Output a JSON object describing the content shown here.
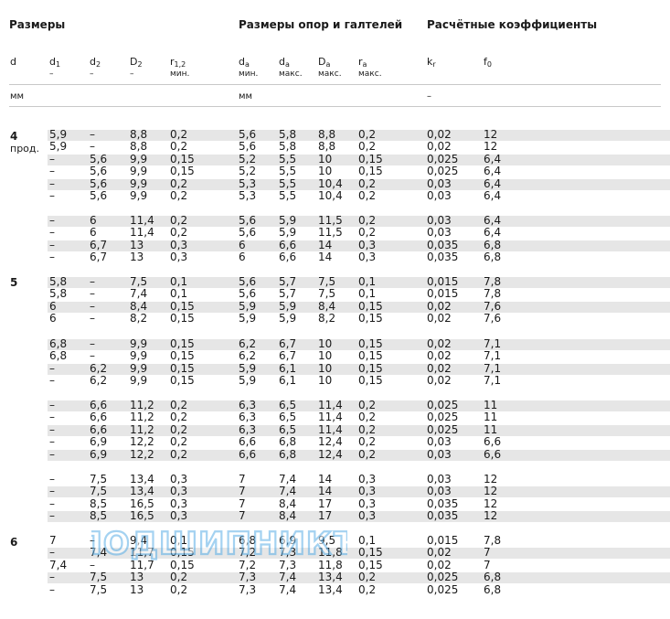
{
  "sections": {
    "sizes": "Размеры",
    "abutment": "Размеры опор и галтелей",
    "factors": "Расчётные коэффициенты"
  },
  "columns": [
    {
      "key": "d",
      "label": "d",
      "sub": "",
      "line2": ""
    },
    {
      "key": "d1",
      "label": "d",
      "sub": "1",
      "line2": "–"
    },
    {
      "key": "d2",
      "label": "d",
      "sub": "2",
      "line2": "–"
    },
    {
      "key": "D2",
      "label": "D",
      "sub": "2",
      "line2": "–"
    },
    {
      "key": "r12",
      "label": "r",
      "sub": "1,2",
      "line2": "мин."
    },
    {
      "key": "da_min",
      "label": "d",
      "sub": "a",
      "line2": "мин."
    },
    {
      "key": "da_max",
      "label": "d",
      "sub": "a",
      "line2": "макс."
    },
    {
      "key": "Da_max",
      "label": "D",
      "sub": "a",
      "line2": "макс."
    },
    {
      "key": "ra_max",
      "label": "r",
      "sub": "a",
      "line2": "макс."
    },
    {
      "key": "kr",
      "label": "k",
      "sub": "r",
      "line2": ""
    },
    {
      "key": "f0",
      "label": "f",
      "sub": "0",
      "line2": ""
    }
  ],
  "units": {
    "sizes": "мм",
    "abutment": "мм",
    "factors": "–"
  },
  "groups": [
    {
      "d": "4",
      "cont": "прод."
    },
    {
      "d": "5",
      "cont": ""
    },
    {
      "d": "6",
      "cont": ""
    }
  ],
  "rows": [
    [
      "5,9",
      "–",
      "8,8",
      "0,2",
      "5,6",
      "5,8",
      "8,8",
      "0,2",
      "0,02",
      "12"
    ],
    [
      "5,9",
      "–",
      "8,8",
      "0,2",
      "5,6",
      "5,8",
      "8,8",
      "0,2",
      "0,02",
      "12"
    ],
    [
      "–",
      "5,6",
      "9,9",
      "0,15",
      "5,2",
      "5,5",
      "10",
      "0,15",
      "0,025",
      "6,4"
    ],
    [
      "–",
      "5,6",
      "9,9",
      "0,15",
      "5,2",
      "5,5",
      "10",
      "0,15",
      "0,025",
      "6,4"
    ],
    [
      "–",
      "5,6",
      "9,9",
      "0,2",
      "5,3",
      "5,5",
      "10,4",
      "0,2",
      "0,03",
      "6,4"
    ],
    [
      "–",
      "5,6",
      "9,9",
      "0,2",
      "5,3",
      "5,5",
      "10,4",
      "0,2",
      "0,03",
      "6,4"
    ],
    [
      "–",
      "6",
      "11,4",
      "0,2",
      "5,6",
      "5,9",
      "11,5",
      "0,2",
      "0,03",
      "6,4"
    ],
    [
      "–",
      "6",
      "11,4",
      "0,2",
      "5,6",
      "5,9",
      "11,5",
      "0,2",
      "0,03",
      "6,4"
    ],
    [
      "–",
      "6,7",
      "13",
      "0,3",
      "6",
      "6,6",
      "14",
      "0,3",
      "0,035",
      "6,8"
    ],
    [
      "–",
      "6,7",
      "13",
      "0,3",
      "6",
      "6,6",
      "14",
      "0,3",
      "0,035",
      "6,8"
    ],
    [
      "5,8",
      "–",
      "7,5",
      "0,1",
      "5,6",
      "5,7",
      "7,5",
      "0,1",
      "0,015",
      "7,8"
    ],
    [
      "5,8",
      "–",
      "7,4",
      "0,1",
      "5,6",
      "5,7",
      "7,5",
      "0,1",
      "0,015",
      "7,8"
    ],
    [
      "6",
      "–",
      "8,4",
      "0,15",
      "5,9",
      "5,9",
      "8,4",
      "0,15",
      "0,02",
      "7,6"
    ],
    [
      "6",
      "–",
      "8,2",
      "0,15",
      "5,9",
      "5,9",
      "8,2",
      "0,15",
      "0,02",
      "7,6"
    ],
    [
      "6,8",
      "–",
      "9,9",
      "0,15",
      "6,2",
      "6,7",
      "10",
      "0,15",
      "0,02",
      "7,1"
    ],
    [
      "6,8",
      "–",
      "9,9",
      "0,15",
      "6,2",
      "6,7",
      "10",
      "0,15",
      "0,02",
      "7,1"
    ],
    [
      "–",
      "6,2",
      "9,9",
      "0,15",
      "5,9",
      "6,1",
      "10",
      "0,15",
      "0,02",
      "7,1"
    ],
    [
      "–",
      "6,2",
      "9,9",
      "0,15",
      "5,9",
      "6,1",
      "10",
      "0,15",
      "0,02",
      "7,1"
    ],
    [
      "–",
      "6,6",
      "11,2",
      "0,2",
      "6,3",
      "6,5",
      "11,4",
      "0,2",
      "0,025",
      "11"
    ],
    [
      "–",
      "6,6",
      "11,2",
      "0,2",
      "6,3",
      "6,5",
      "11,4",
      "0,2",
      "0,025",
      "11"
    ],
    [
      "–",
      "6,6",
      "11,2",
      "0,2",
      "6,3",
      "6,5",
      "11,4",
      "0,2",
      "0,025",
      "11"
    ],
    [
      "–",
      "6,9",
      "12,2",
      "0,2",
      "6,6",
      "6,8",
      "12,4",
      "0,2",
      "0,03",
      "6,6"
    ],
    [
      "–",
      "6,9",
      "12,2",
      "0,2",
      "6,6",
      "6,8",
      "12,4",
      "0,2",
      "0,03",
      "6,6"
    ],
    [
      "–",
      "7,5",
      "13,4",
      "0,3",
      "7",
      "7,4",
      "14",
      "0,3",
      "0,03",
      "12"
    ],
    [
      "–",
      "7,5",
      "13,4",
      "0,3",
      "7",
      "7,4",
      "14",
      "0,3",
      "0,03",
      "12"
    ],
    [
      "–",
      "8,5",
      "16,5",
      "0,3",
      "7",
      "8,4",
      "17",
      "0,3",
      "0,035",
      "12"
    ],
    [
      "–",
      "8,5",
      "16,5",
      "0,3",
      "7",
      "8,4",
      "17",
      "0,3",
      "0,035",
      "12"
    ],
    [
      "7",
      "–",
      "9,4",
      "0,1",
      "6,8",
      "6,9",
      "9,5",
      "0,1",
      "0,015",
      "7,8"
    ],
    [
      "–",
      "7,4",
      "11,7",
      "0,15",
      "7,2",
      "7,3",
      "11,8",
      "0,15",
      "0,02",
      "7"
    ],
    [
      "7,4",
      "–",
      "11,7",
      "0,15",
      "7,2",
      "7,3",
      "11,8",
      "0,15",
      "0,02",
      "7"
    ],
    [
      "–",
      "7,5",
      "13",
      "0,2",
      "7,3",
      "7,4",
      "13,4",
      "0,2",
      "0,025",
      "6,8"
    ],
    [
      "–",
      "7,5",
      "13",
      "0,2",
      "7,3",
      "7,4",
      "13,4",
      "0,2",
      "0,025",
      "6,8"
    ]
  ],
  "watermark": "ПОДШИПНИКЪ"
}
